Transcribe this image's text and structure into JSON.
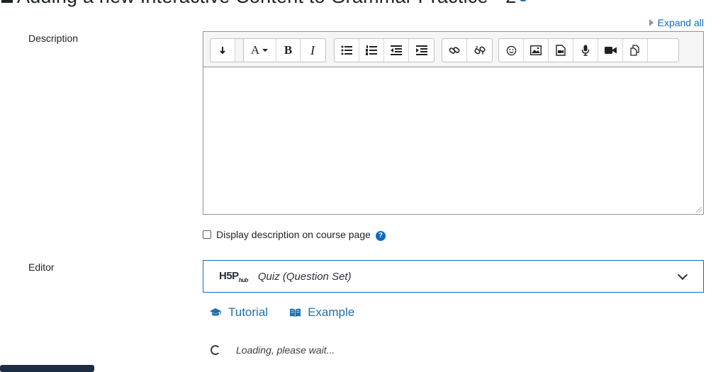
{
  "page": {
    "title": "Adding a new Interactive Content to Grammar Practice - 2"
  },
  "header": {
    "expand_all": "Expand all"
  },
  "description": {
    "label": "Description",
    "toolbar": {
      "groups": [
        [
          "collapse-icon",
          "font-style-icon",
          "bold-icon",
          "italic-icon"
        ],
        [
          "unordered-list-icon",
          "ordered-list-icon",
          "outdent-icon",
          "indent-icon"
        ],
        [
          "link-icon",
          "unlink-icon"
        ],
        [
          "emoji-icon",
          "image-icon",
          "media-icon",
          "record-audio-icon",
          "record-video-icon",
          "manage-files-icon"
        ]
      ],
      "bold_glyph": "B",
      "italic_glyph": "I",
      "font_glyph": "A"
    },
    "textarea_value": ""
  },
  "display_description": {
    "label": "Display description on course page",
    "checked": false
  },
  "editor": {
    "label": "Editor",
    "hub_logo": "H5P",
    "hub_logo_sub": "hub",
    "selected": "Quiz (Question Set)",
    "links": {
      "tutorial": "Tutorial",
      "example": "Example"
    },
    "loading_text": "Loading, please wait..."
  },
  "colors": {
    "accent": "#0f6cbf",
    "text": "#1d2125",
    "link": "#1f6fab"
  }
}
